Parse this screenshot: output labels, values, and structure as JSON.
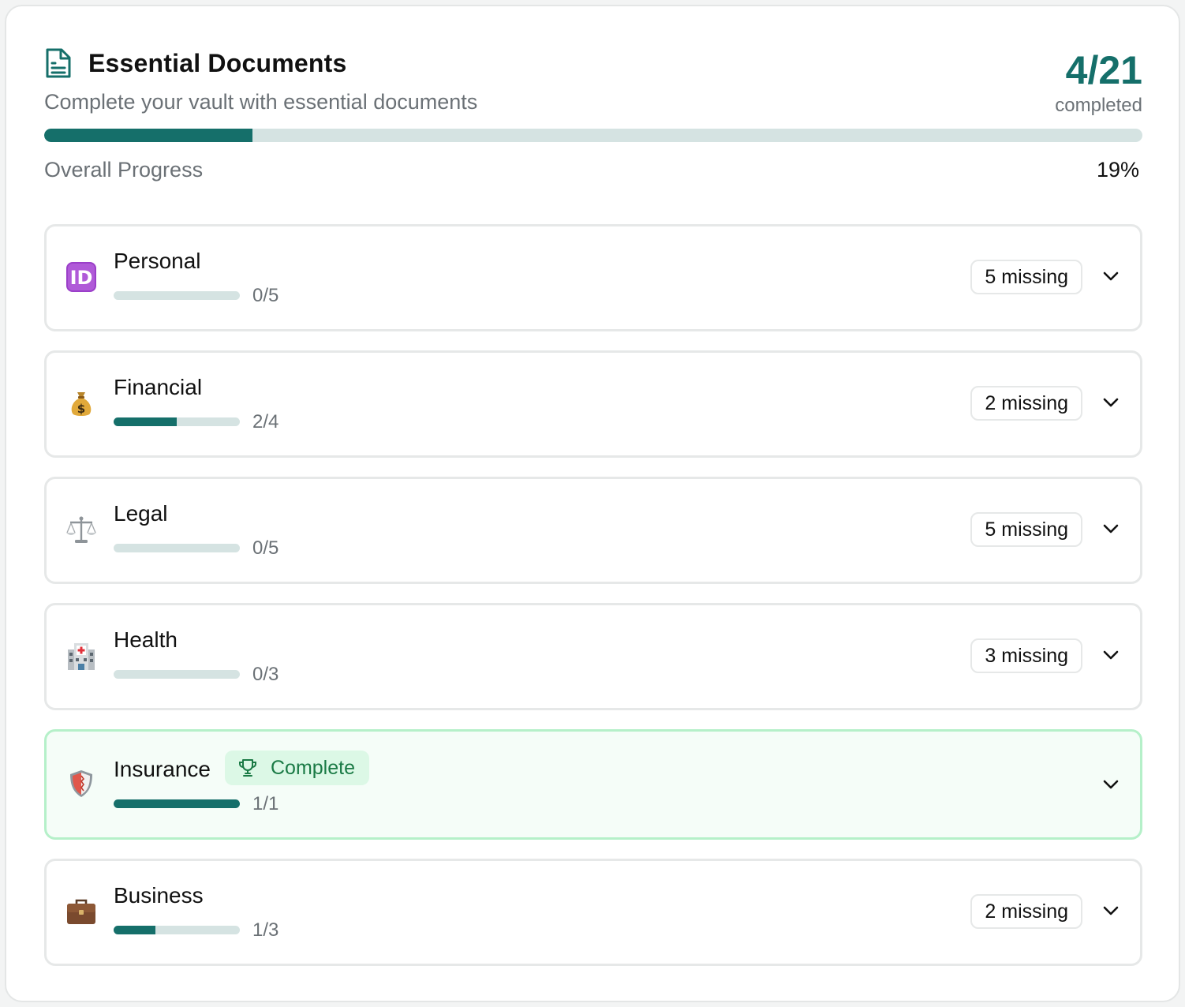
{
  "header": {
    "title": "Essential Documents",
    "subtitle": "Complete your vault with essential documents",
    "count": "4/21",
    "count_label": "completed",
    "icon": "document-icon"
  },
  "overall": {
    "label": "Overall Progress",
    "percent_text": "19%",
    "progress": 0.19
  },
  "colors": {
    "accent": "#156f6a",
    "track": "#d5e3e2",
    "complete_bg": "#f5fdf8",
    "complete_border": "#b5f0c9",
    "complete_text": "#1a7a45"
  },
  "categories": [
    {
      "name": "Personal",
      "icon": "id-icon",
      "count": "0/5",
      "progress": 0.0,
      "missing": "5 missing"
    },
    {
      "name": "Financial",
      "icon": "money-bag-icon",
      "count": "2/4",
      "progress": 0.5,
      "missing": "2 missing"
    },
    {
      "name": "Legal",
      "icon": "scales-icon",
      "count": "0/5",
      "progress": 0.0,
      "missing": "5 missing"
    },
    {
      "name": "Health",
      "icon": "hospital-icon",
      "count": "0/3",
      "progress": 0.0,
      "missing": "3 missing"
    },
    {
      "name": "Insurance",
      "icon": "shield-icon",
      "count": "1/1",
      "progress": 1.0,
      "status": "Complete",
      "status_icon": "trophy-icon"
    },
    {
      "name": "Business",
      "icon": "briefcase-icon",
      "count": "1/3",
      "progress": 0.3333,
      "missing": "2 missing"
    }
  ]
}
